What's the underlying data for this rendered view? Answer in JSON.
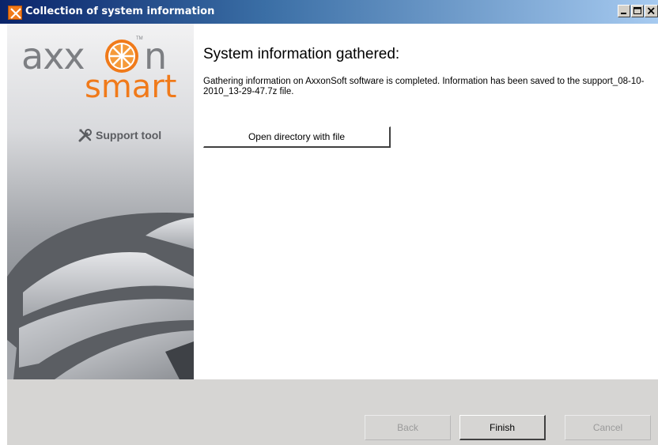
{
  "window": {
    "title": "Collection of system information",
    "title_bar_color": "#0a246a",
    "app_icon": "axxon-support-tool-icon"
  },
  "banner": {
    "logo_text_1": "axx",
    "logo_text_2": "n",
    "logo_text_3": "smart",
    "logo_trademark": "TM",
    "tool_label": "Support tool",
    "tool_icon": "wrench-screwdriver-icon",
    "brand_orange": "#f07a1a",
    "brand_gray": "#7d7f83"
  },
  "main": {
    "heading": "System information gathered:",
    "description": "Gathering information on AxxonSoft software is completed. Information has been saved to the support_08-10-2010_13-29-47.7z file.",
    "open_directory_label": "Open directory with file"
  },
  "footer": {
    "back_label": "Back",
    "finish_label": "Finish",
    "cancel_label": "Cancel"
  }
}
